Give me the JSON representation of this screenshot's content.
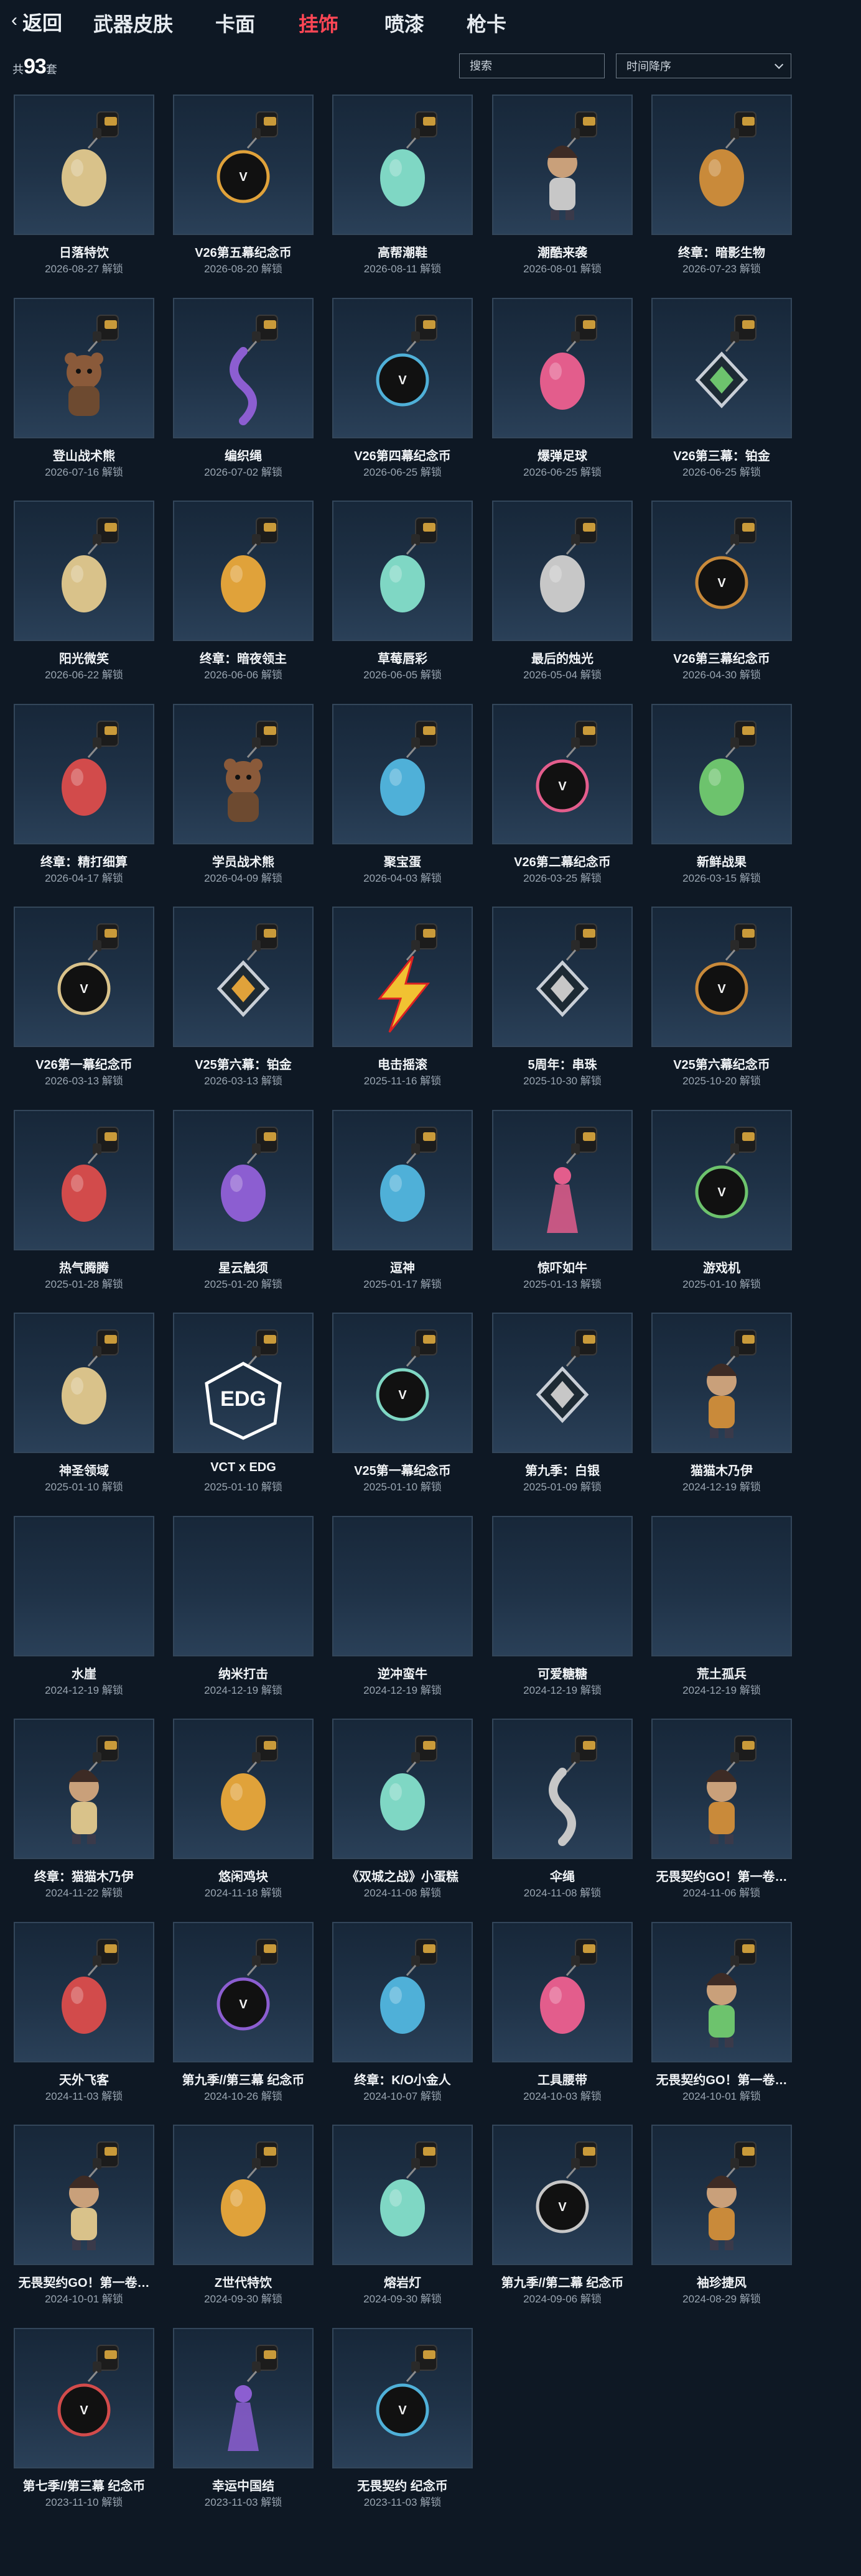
{
  "nav": {
    "back_label": "返回",
    "tabs": [
      {
        "label": "武器皮肤",
        "active": false
      },
      {
        "label": "卡面",
        "active": false
      },
      {
        "label": "挂饰",
        "active": true
      },
      {
        "label": "喷漆",
        "active": false
      },
      {
        "label": "枪卡",
        "active": false
      }
    ]
  },
  "toolbar": {
    "count_prefix": "共",
    "count": "93",
    "count_suffix": "套",
    "search_placeholder": "搜索",
    "sort_label": "时间降序"
  },
  "colors": {
    "accent": "#ff4655",
    "background": "#0e1824",
    "tile_border": "#33465a"
  },
  "items": [
    {
      "name": "日落特饮",
      "date": "2026-08-27 解锁",
      "icon": "mug-charm"
    },
    {
      "name": "V26第五幕纪念币",
      "date": "2026-08-20 解锁",
      "icon": "coin-charm"
    },
    {
      "name": "高帮潮鞋",
      "date": "2026-08-11 解锁",
      "icon": "sneaker-charm"
    },
    {
      "name": "潮酷来袭",
      "date": "2026-08-01 解锁",
      "icon": "figure-charm"
    },
    {
      "name": "终章：暗影生物",
      "date": "2026-07-23 解锁",
      "icon": "creature-charm"
    },
    {
      "name": "登山战术熊",
      "date": "2026-07-16 解锁",
      "icon": "bear-charm"
    },
    {
      "name": "编织绳",
      "date": "2026-07-02 解锁",
      "icon": "rope-charm"
    },
    {
      "name": "V26第四幕纪念币",
      "date": "2026-06-25 解锁",
      "icon": "coin-charm"
    },
    {
      "name": "爆弹足球",
      "date": "2026-06-25 解锁",
      "icon": "ball-charm"
    },
    {
      "name": "V26第三幕：铂金",
      "date": "2026-06-25 解锁",
      "icon": "badge-charm"
    },
    {
      "name": "阳光微笑",
      "date": "2026-06-22 解锁",
      "icon": "orb-charm"
    },
    {
      "name": "终章：暗夜领主",
      "date": "2026-06-06 解锁",
      "icon": "creature-charm"
    },
    {
      "name": "草莓唇彩",
      "date": "2026-06-05 解锁",
      "icon": "lipstick-charm"
    },
    {
      "name": "最后的烛光",
      "date": "2026-05-04 解锁",
      "icon": "candle-charm"
    },
    {
      "name": "V26第三幕纪念币",
      "date": "2026-04-30 解锁",
      "icon": "coin-charm"
    },
    {
      "name": "终章：精打细算",
      "date": "2026-04-17 解锁",
      "icon": "orb-charm"
    },
    {
      "name": "学员战术熊",
      "date": "2026-04-09 解锁",
      "icon": "bear-charm"
    },
    {
      "name": "聚宝蛋",
      "date": "2026-04-03 解锁",
      "icon": "egg-charm"
    },
    {
      "name": "V26第二幕纪念币",
      "date": "2026-03-25 解锁",
      "icon": "coin-charm"
    },
    {
      "name": "新鲜战果",
      "date": "2026-03-15 解锁",
      "icon": "leaf-charm"
    },
    {
      "name": "V26第一幕纪念币",
      "date": "2026-03-13 解锁",
      "icon": "coin-charm"
    },
    {
      "name": "V25第六幕：铂金",
      "date": "2026-03-13 解锁",
      "icon": "badge-charm"
    },
    {
      "name": "电击摇滚",
      "date": "2025-11-16 解锁",
      "icon": "bolt-charm"
    },
    {
      "name": "5周年：串珠",
      "date": "2025-10-30 解锁",
      "icon": "badge-charm"
    },
    {
      "name": "V25第六幕纪念币",
      "date": "2025-10-20 解锁",
      "icon": "coin-charm"
    },
    {
      "name": "热气腾腾",
      "date": "2025-01-28 解锁",
      "icon": "lamp-charm"
    },
    {
      "name": "星云触须",
      "date": "2025-01-20 解锁",
      "icon": "plant-charm"
    },
    {
      "name": "逗神",
      "date": "2025-01-17 解锁",
      "icon": "jar-charm"
    },
    {
      "name": "惊吓如牛",
      "date": "2025-01-13 解锁",
      "icon": "tassel-charm"
    },
    {
      "name": "游戏机",
      "date": "2025-01-10 解锁",
      "icon": "coin-charm"
    },
    {
      "name": "神圣领域",
      "date": "2025-01-10 解锁",
      "icon": "bottle-charm"
    },
    {
      "name": "VCT x EDG",
      "date": "2025-01-10 解锁",
      "icon": "edg-charm"
    },
    {
      "name": "V25第一幕纪念币",
      "date": "2025-01-10 解锁",
      "icon": "coin-charm"
    },
    {
      "name": "第九季：白银",
      "date": "2025-01-09 解锁",
      "icon": "badge-charm"
    },
    {
      "name": "猫猫木乃伊",
      "date": "2024-12-19 解锁",
      "icon": "figure-charm"
    },
    {
      "name": "水崖",
      "date": "2024-12-19 解锁",
      "icon": "empty"
    },
    {
      "name": "纳米打击",
      "date": "2024-12-19 解锁",
      "icon": "empty"
    },
    {
      "name": "逆冲蛮牛",
      "date": "2024-12-19 解锁",
      "icon": "empty"
    },
    {
      "name": "可爱糖糖",
      "date": "2024-12-19 解锁",
      "icon": "empty"
    },
    {
      "name": "荒土孤兵",
      "date": "2024-12-19 解锁",
      "icon": "empty"
    },
    {
      "name": "终章：猫猫木乃伊",
      "date": "2024-11-22 解锁",
      "icon": "figure-charm"
    },
    {
      "name": "悠闲鸡块",
      "date": "2024-11-18 解锁",
      "icon": "tub-charm"
    },
    {
      "name": "《双城之战》小蛋糕",
      "date": "2024-11-08 解锁",
      "icon": "cupcake-charm"
    },
    {
      "name": "伞绳",
      "date": "2024-11-08 解锁",
      "icon": "rope-charm"
    },
    {
      "name": "无畏契约GO！第一卷…",
      "date": "2024-11-06 解锁",
      "icon": "figure-charm"
    },
    {
      "name": "天外飞客",
      "date": "2024-11-03 解锁",
      "icon": "ufo-charm"
    },
    {
      "name": "第九季//第三幕 纪念币",
      "date": "2024-10-26 解锁",
      "icon": "coin-charm"
    },
    {
      "name": "终章：K/O小金人",
      "date": "2024-10-07 解锁",
      "icon": "robot-charm"
    },
    {
      "name": "工具腰带",
      "date": "2024-10-03 解锁",
      "icon": "belt-charm"
    },
    {
      "name": "无畏契约GO！第一卷…",
      "date": "2024-10-01 解锁",
      "icon": "figure-charm"
    },
    {
      "name": "无畏契约GO！第一卷…",
      "date": "2024-10-01 解锁",
      "icon": "figure-charm"
    },
    {
      "name": "Z世代特饮",
      "date": "2024-09-30 解锁",
      "icon": "can-charm"
    },
    {
      "name": "熔岩灯",
      "date": "2024-09-30 解锁",
      "icon": "lavalamp-charm"
    },
    {
      "name": "第九季//第二幕 纪念币",
      "date": "2024-09-06 解锁",
      "icon": "coin-charm"
    },
    {
      "name": "袖珍捷风",
      "date": "2024-08-29 解锁",
      "icon": "figure-charm"
    },
    {
      "name": "第七季//第三幕 纪念币",
      "date": "2023-11-10 解锁",
      "icon": "coin-charm"
    },
    {
      "name": "幸运中国结",
      "date": "2023-11-03 解锁",
      "icon": "tassel-charm"
    },
    {
      "name": "无畏契约 纪念币",
      "date": "2023-11-03 解锁",
      "icon": "coin-charm"
    }
  ]
}
